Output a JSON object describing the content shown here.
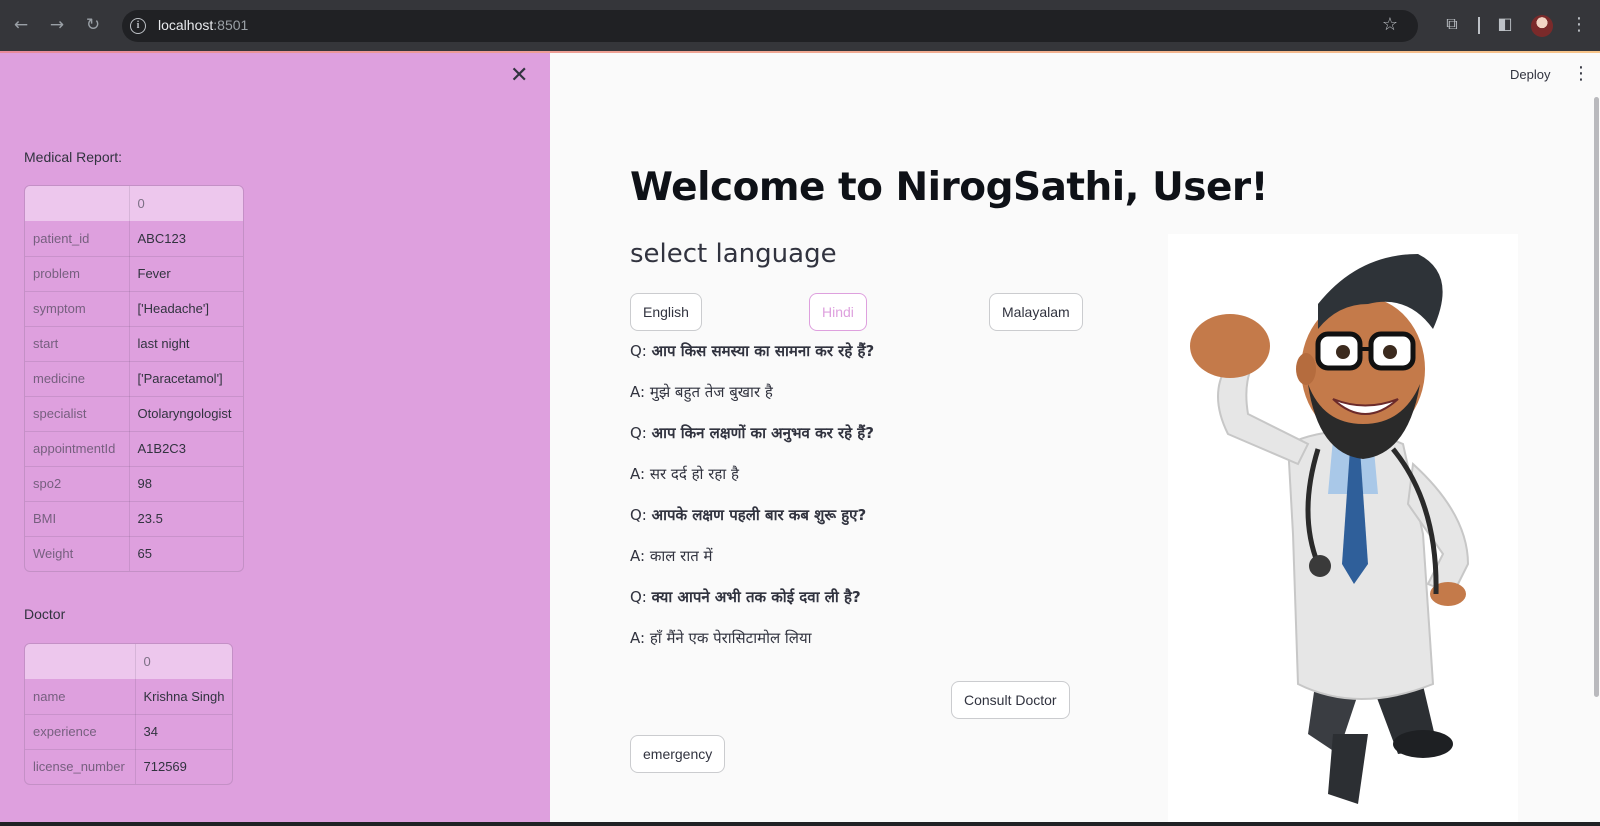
{
  "browser": {
    "url_host": "localhost",
    "url_port": ":8501"
  },
  "sidebar": {
    "medical_report_label": "Medical Report:",
    "medical_report_header": "0",
    "medical_report_rows": [
      {
        "key": "patient_id",
        "value": "ABC123"
      },
      {
        "key": "problem",
        "value": "Fever"
      },
      {
        "key": "symptom",
        "value": "['Headache']"
      },
      {
        "key": "start",
        "value": "last night"
      },
      {
        "key": "medicine",
        "value": "['Paracetamol']"
      },
      {
        "key": "specialist",
        "value": "Otolaryngologist"
      },
      {
        "key": "appointmentId",
        "value": "A1B2C3"
      },
      {
        "key": "spo2",
        "value": "98"
      },
      {
        "key": "BMI",
        "value": "23.5"
      },
      {
        "key": "Weight",
        "value": "65"
      }
    ],
    "doctor_label": "Doctor",
    "doctor_header": "0",
    "doctor_rows": [
      {
        "key": "name",
        "value": "Krishna Singh"
      },
      {
        "key": "experience",
        "value": "34"
      },
      {
        "key": "license_number",
        "value": "712569"
      }
    ]
  },
  "header": {
    "deploy_label": "Deploy"
  },
  "main": {
    "title": "Welcome to NirogSathi, User!",
    "subtitle": "select language",
    "language_buttons": [
      "English",
      "Hindi",
      "Malayalam"
    ],
    "selected_language": "Hindi",
    "qa": [
      {
        "prefix": "Q:",
        "text": "आप किस समस्या का सामना कर रहे हैं?"
      },
      {
        "prefix": "A:",
        "text": "मुझे बहुत तेज बुखार है"
      },
      {
        "prefix": "Q:",
        "text": "आप किन लक्षणों का अनुभव कर रहे हैं?"
      },
      {
        "prefix": "A:",
        "text": "सर दर्द हो रहा है"
      },
      {
        "prefix": "Q:",
        "text": "आपके लक्षण पहली बार कब शुरू हुए?"
      },
      {
        "prefix": "A:",
        "text": "काल रात में"
      },
      {
        "prefix": "Q:",
        "text": "क्या आपने अभी तक कोई दवा ली है?"
      },
      {
        "prefix": "A:",
        "text": "हाँ मैंने एक पेरासिटामोल लिया"
      }
    ],
    "consult_button": "Consult Doctor",
    "emergency_button": "emergency"
  },
  "colors": {
    "sidebar_bg": "#dea0de",
    "accent": "#dea0de",
    "main_bg": "#fafafa"
  }
}
